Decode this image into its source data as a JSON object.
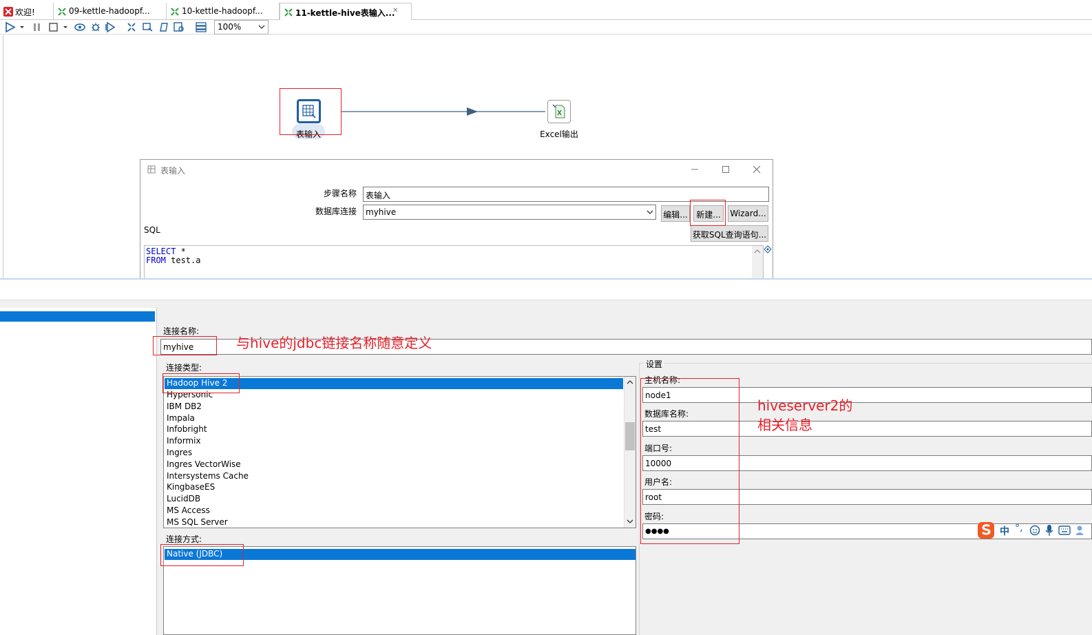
{
  "tabs": [
    {
      "label": "欢迎!"
    },
    {
      "label": "09-kettle-hadoopf..."
    },
    {
      "label": "10-kettle-hadoopf..."
    },
    {
      "label": "11-kettle-hive表输入...",
      "close": "✕"
    }
  ],
  "toolbar": {
    "zoom": "100%"
  },
  "canvas": {
    "step1_label": "表输入",
    "step2_label": "Excel输出"
  },
  "table_input_dialog": {
    "title": "表输入",
    "step_name_label": "步骤名称",
    "step_name_value": "表输入",
    "db_conn_label": "数据库连接",
    "db_conn_value": "myhive",
    "edit_button": "编辑...",
    "new_button": "新建...",
    "wizard_button": "Wizard...",
    "get_sql_button": "获取SQL查询语句...",
    "sql_label": "SQL",
    "sql_line1_kw": "SELECT",
    "sql_line1_rest": " *",
    "sql_line2_kw": "FROM",
    "sql_line2_rest": " test.a"
  },
  "db_dialog": {
    "conn_name_label": "连接名称:",
    "conn_name_value": "myhive",
    "conn_type_label": "连接类型:",
    "conn_types": [
      "Hadoop Hive 2",
      "Hypersonic",
      "IBM DB2",
      "Impala",
      "Infobright",
      "Informix",
      "Ingres",
      "Ingres VectorWise",
      "Intersystems Cache",
      "KingbaseES",
      "LucidDB",
      "MS Access",
      "MS SQL Server"
    ],
    "selected_type": "Hadoop Hive 2",
    "access_label": "连接方式:",
    "access_value": "Native (JDBC)",
    "settings_label": "设置",
    "host_label": "主机名称:",
    "host_value": "node1",
    "dbname_label": "数据库名称:",
    "dbname_value": "test",
    "port_label": "端口号:",
    "port_value": "10000",
    "user_label": "用户名:",
    "user_value": "root",
    "password_label": "密码:",
    "password_value": "●●●●"
  },
  "annotations": {
    "conn_name_note": "与hive的jdbc链接名称随意定义",
    "settings_note_line1": "hiveserver2的",
    "settings_note_line2": "相关信息"
  },
  "ime": {
    "label": "中",
    "punct": "°,"
  },
  "colors": {
    "selection": "#0a78d7",
    "annotation": "#e8202a",
    "step_blue": "#1f5f9e"
  }
}
